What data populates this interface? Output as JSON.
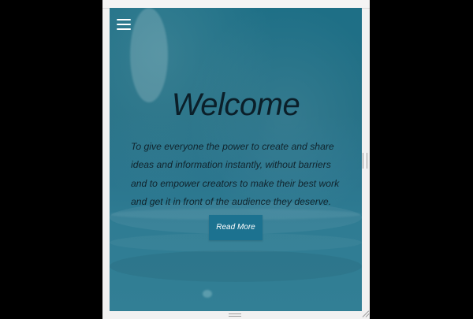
{
  "viewport": {
    "brand_background": "#236f85",
    "button_color": "#1c7290"
  },
  "nav": {
    "menu_icon": "hamburger-icon"
  },
  "hero": {
    "title": "Welcome",
    "description": "To give everyone the power to create and share ideas and information instantly, without barriers and to empower creators to make their best work and get it in front of the audience they deserve.",
    "button_label": "Read More"
  },
  "frame": {
    "resize_icon": "resize-grip-icon",
    "bottom_handle_icon": "drag-handle-icon"
  }
}
